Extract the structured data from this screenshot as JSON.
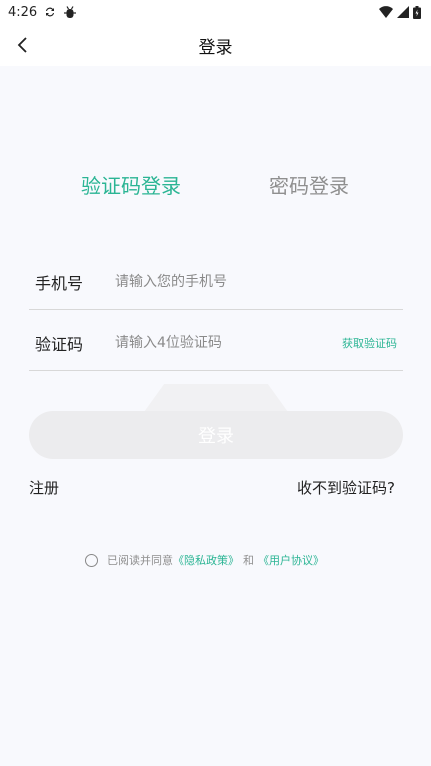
{
  "status_bar": {
    "time": "4:26",
    "icons": [
      "sync-icon",
      "bug-icon",
      "wifi-icon",
      "signal-icon",
      "battery-icon"
    ]
  },
  "nav": {
    "title": "登录",
    "back_icon": "chevron-left-icon"
  },
  "tabs": [
    {
      "label": "验证码登录",
      "active": true
    },
    {
      "label": "密码登录",
      "active": false
    }
  ],
  "phone_field": {
    "label": "手机号",
    "placeholder": "请输入您的手机号",
    "value": ""
  },
  "code_field": {
    "label": "验证码",
    "placeholder": "请输入4位验证码",
    "value": "",
    "get_code_label": "获取验证码"
  },
  "login_button": {
    "label": "登录"
  },
  "links": {
    "register": "注册",
    "no_code": "收不到验证码?"
  },
  "agreement": {
    "prefix": "已阅读并同意",
    "privacy_policy": "《隐私政策》",
    "and": "和",
    "user_agreement": "《用户协议》",
    "checked": false
  },
  "colors": {
    "accent": "#2bb594",
    "background": "#f8f9fd",
    "button_disabled": "#ececee",
    "inactive_text": "#8f8f8f"
  }
}
